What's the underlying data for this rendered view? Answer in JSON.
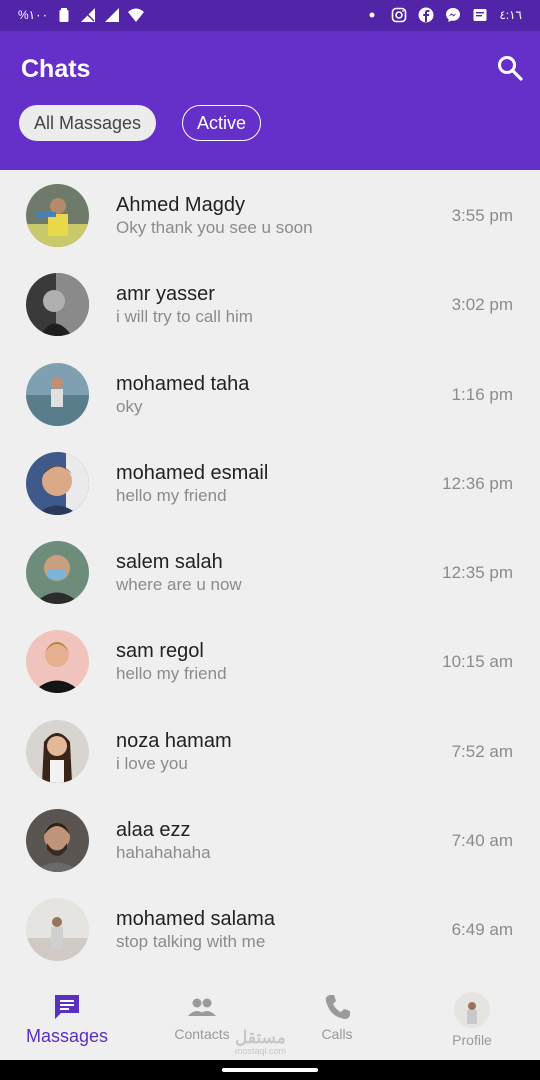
{
  "status_bar": {
    "battery_text": "%١٠٠",
    "clock": "٤:١٦"
  },
  "header": {
    "title": "Chats"
  },
  "filters": [
    {
      "label": "All Massages"
    },
    {
      "label": "Active"
    }
  ],
  "chats": [
    {
      "name": "Ahmed Magdy",
      "message": "Oky thank you see u soon",
      "time": "3:55 pm"
    },
    {
      "name": "amr yasser",
      "message": "i will try to call him",
      "time": "3:02 pm"
    },
    {
      "name": "mohamed taha",
      "message": "oky",
      "time": "1:16 pm"
    },
    {
      "name": "mohamed esmail",
      "message": "hello my friend",
      "time": "12:36 pm"
    },
    {
      "name": "salem salah",
      "message": "where are u now",
      "time": "12:35 pm"
    },
    {
      "name": "sam regol",
      "message": "hello my friend",
      "time": "10:15 am"
    },
    {
      "name": "noza hamam",
      "message": "i love you",
      "time": "7:52 am"
    },
    {
      "name": "alaa ezz",
      "message": "hahahahaha",
      "time": "7:40 am"
    },
    {
      "name": "mohamed salama",
      "message": "stop talking with me",
      "time": "6:49 am"
    }
  ],
  "bottom_nav": [
    {
      "label": "Massages",
      "icon": "chat-icon"
    },
    {
      "label": "Contacts",
      "icon": "people-icon"
    },
    {
      "label": "Calls",
      "icon": "phone-icon"
    },
    {
      "label": "Profile",
      "icon": "avatar"
    }
  ],
  "watermark": {
    "text": "mostaql.com",
    "logo_text": "مستقل"
  },
  "colors": {
    "primary": "#6530c9",
    "status_bar": "#5124a8",
    "active_nav": "#5b2fc0"
  }
}
